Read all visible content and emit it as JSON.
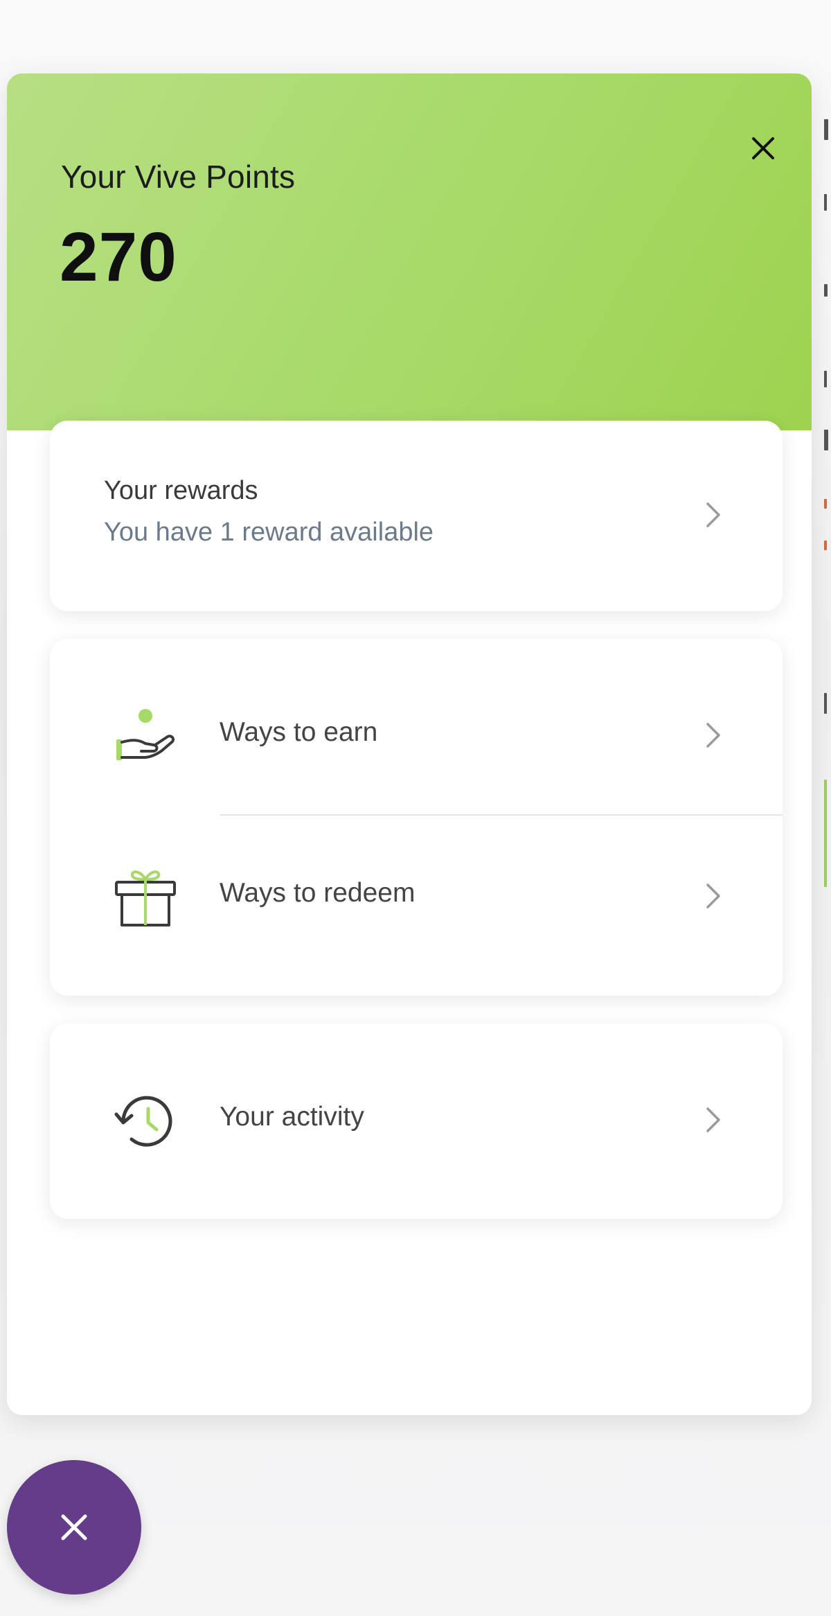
{
  "widget": {
    "title": "Your Vive Points",
    "points": "270",
    "colors": {
      "header_green": "#a6d966",
      "fab_purple": "#653c8a",
      "subtext": "#6c7a8c"
    }
  },
  "rewards_card": {
    "title": "Your rewards",
    "subtitle": "You have 1 reward available"
  },
  "menu": {
    "ways_to_earn": {
      "label": "Ways to earn",
      "icon": "hand-coin-icon"
    },
    "ways_to_redeem": {
      "label": "Ways to redeem",
      "icon": "gift-icon"
    },
    "your_activity": {
      "label": "Your activity",
      "icon": "history-clock-icon"
    }
  },
  "launcher": {
    "icon": "close-icon"
  }
}
